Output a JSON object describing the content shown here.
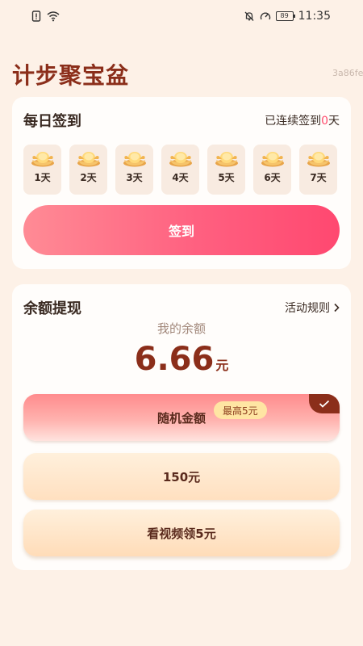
{
  "status_bar": {
    "time": "11:35",
    "battery": "89",
    "icons": [
      "sim-alert-icon",
      "wifi-icon",
      "mute-bell-icon",
      "speed-icon"
    ]
  },
  "app": {
    "title": "计步聚宝盆",
    "version_tag": "3a86fe"
  },
  "checkin": {
    "title": "每日签到",
    "streak_prefix": "已连续签到",
    "streak_days": "0",
    "streak_suffix": "天",
    "days": [
      {
        "label": "1天"
      },
      {
        "label": "2天"
      },
      {
        "label": "3天"
      },
      {
        "label": "4天"
      },
      {
        "label": "5天"
      },
      {
        "label": "6天"
      },
      {
        "label": "7天"
      }
    ],
    "button_label": "签到"
  },
  "withdraw": {
    "title": "余额提现",
    "rules_label": "活动规则",
    "balance_label": "我的余额",
    "balance_amount": "6.66",
    "balance_unit": "元",
    "options": {
      "random": {
        "label": "随机金额",
        "badge": "最高5元",
        "selected": true
      },
      "fixed": {
        "label": "150元"
      },
      "video": {
        "label": "看视频领5元"
      }
    }
  },
  "colors": {
    "accent": "#ff4a6b",
    "title": "#8b2e1a",
    "background": "#fdf1e7"
  }
}
